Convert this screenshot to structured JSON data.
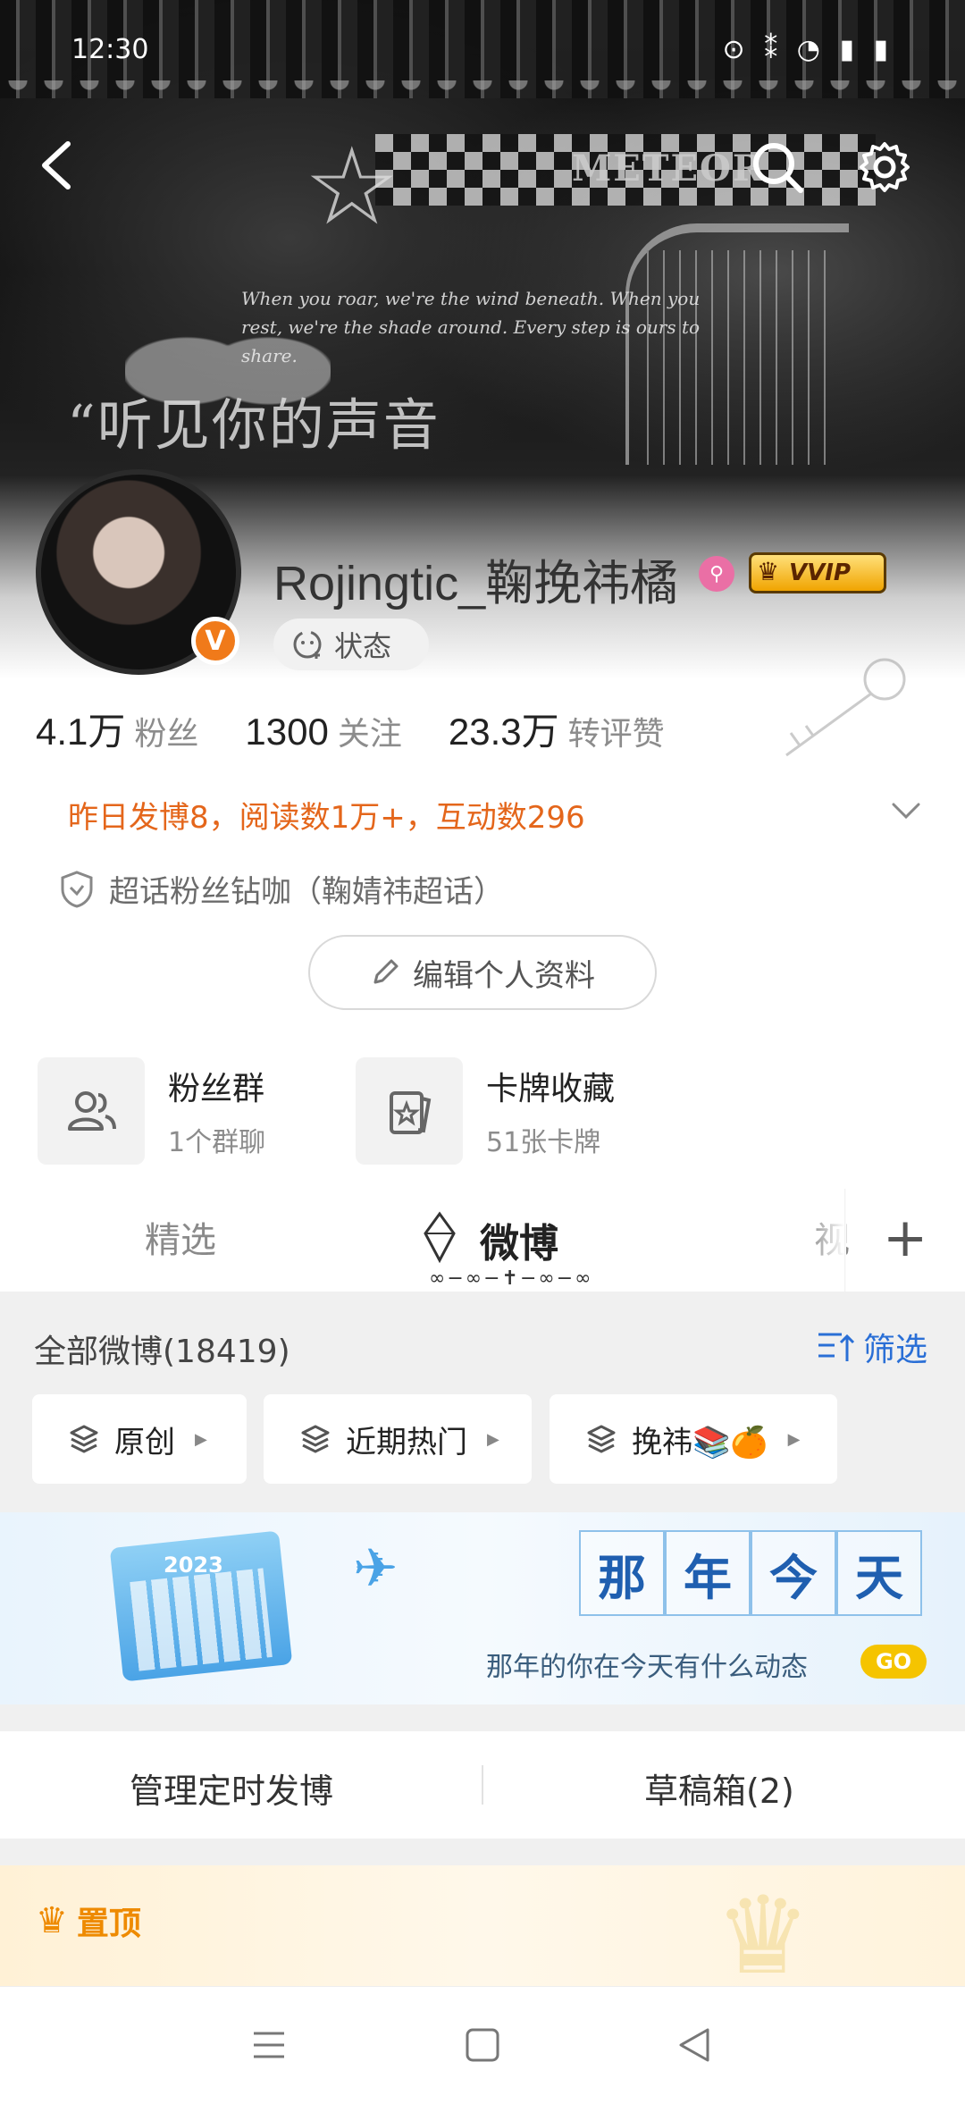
{
  "status_bar": {
    "time": "12:30",
    "right_icons": "⊙ ⁑ ◔ ▮ ▮"
  },
  "banner": {
    "top_text": "When you roar, we're the wind beneath. When you rest, we're the shade around. Every step is ours to share.",
    "title_text": "“听见你的声音",
    "meteor_word": "METEOR"
  },
  "nav": {
    "back_icon": "chevron-left-icon",
    "search_icon": "search-icon",
    "settings_icon": "gear-icon"
  },
  "profile": {
    "username": "Rojingtic_鞠挽祎橘",
    "verified_badge": "V",
    "vvip_label": "VVIP",
    "status_label": "状态",
    "stats": [
      {
        "value": "4.1万",
        "label": "粉丝"
      },
      {
        "value": "1300",
        "label": "关注"
      },
      {
        "value": "23.3万",
        "label": "转评赞"
      }
    ],
    "daily_summary": "昨日发博8，阅读数1万+，互动数296",
    "superhua": "超话粉丝钻咖（鞠婧祎超话）",
    "edit_button": "编辑个人资料"
  },
  "cards": [
    {
      "title": "粉丝群",
      "subtitle": "1个群聊",
      "icon": "users-icon"
    },
    {
      "title": "卡牌收藏",
      "subtitle": "51张卡牌",
      "icon": "card-collection-icon"
    }
  ],
  "tabs": [
    {
      "label": "精选"
    },
    {
      "label": "微博"
    },
    {
      "label": "视"
    }
  ],
  "feed": {
    "all_label": "全部微博(18419)",
    "filter_label": "筛选",
    "chips": [
      "原创",
      "近期热门",
      "挽祎📚🍊"
    ]
  },
  "promo": {
    "title_chars": [
      "那",
      "年",
      "今",
      "天"
    ],
    "subtitle": "那年的你在今天有什么动态",
    "go": "GO",
    "calendar_year": "2023"
  },
  "manage": {
    "scheduled": "管理定时发博",
    "drafts": "草稿箱(2)"
  },
  "pinned": {
    "label": "置顶"
  },
  "colors": {
    "accent_orange": "#e4661b",
    "link_blue": "#2a6fd6",
    "pinned_orange": "#ee8a00"
  }
}
